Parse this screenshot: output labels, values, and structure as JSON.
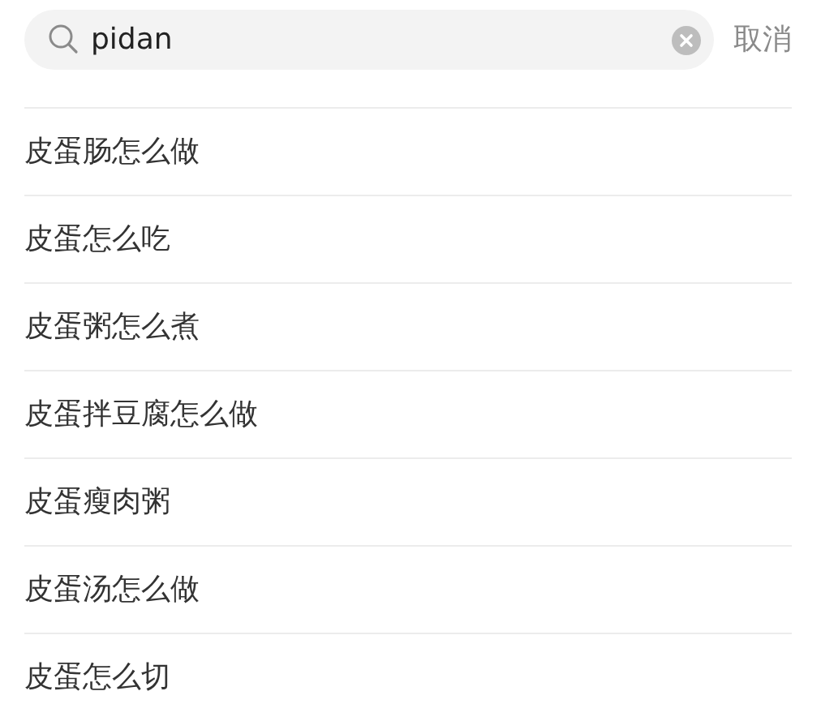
{
  "search": {
    "value": "pidan",
    "cancel": "取消"
  },
  "suggestions": [
    "皮蛋肠怎么做",
    "皮蛋怎么吃",
    "皮蛋粥怎么煮",
    "皮蛋拌豆腐怎么做",
    "皮蛋瘦肉粥",
    "皮蛋汤怎么做",
    "皮蛋怎么切"
  ]
}
